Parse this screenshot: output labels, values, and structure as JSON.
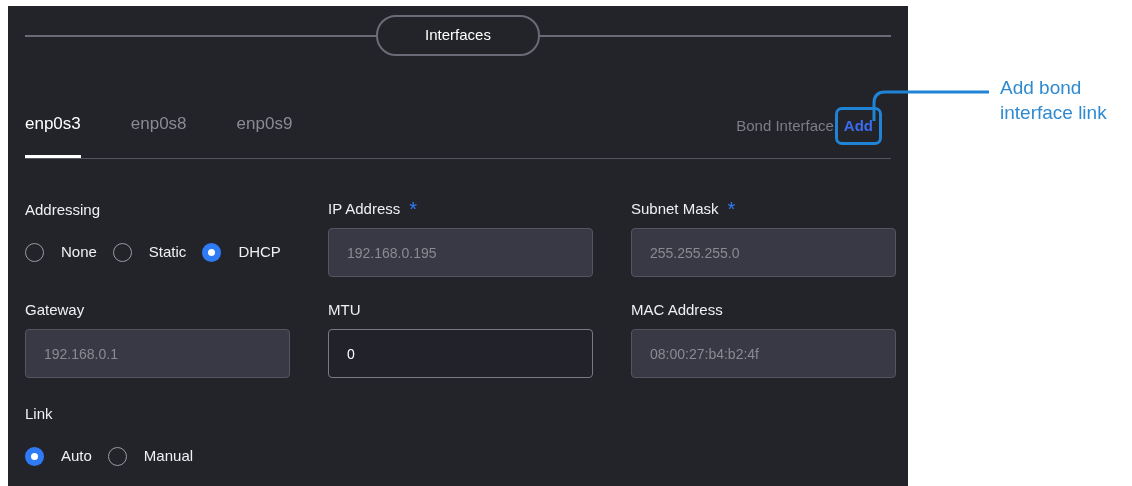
{
  "section": {
    "title": "Interfaces"
  },
  "tabs": [
    {
      "label": "enp0s3",
      "selected": true
    },
    {
      "label": "enp0s8",
      "selected": false
    },
    {
      "label": "enp0s9",
      "selected": false
    }
  ],
  "bond": {
    "label": "Bond Interface",
    "link": "Add"
  },
  "addressing": {
    "label": "Addressing",
    "options": [
      {
        "label": "None",
        "selected": false
      },
      {
        "label": "Static",
        "selected": false
      },
      {
        "label": "DHCP",
        "selected": true
      }
    ]
  },
  "fields": [
    {
      "label": "IP Address",
      "required_mark": "*",
      "value": "192.168.0.195",
      "disabled": true
    },
    {
      "label": "Subnet Mask",
      "required_mark": "*",
      "value": "255.255.255.0",
      "disabled": true
    },
    {
      "label": "Gateway",
      "value": "192.168.0.1",
      "disabled": true
    },
    {
      "label": "MTU",
      "value": "0",
      "disabled": false
    },
    {
      "label": "MAC Address",
      "value": "08:00:27:b4:b2:4f",
      "disabled": true
    }
  ],
  "link": {
    "label": "Link",
    "options": [
      {
        "label": "Auto",
        "selected": true
      },
      {
        "label": "Manual",
        "selected": false
      }
    ]
  },
  "callout": "Add bond interface link"
}
